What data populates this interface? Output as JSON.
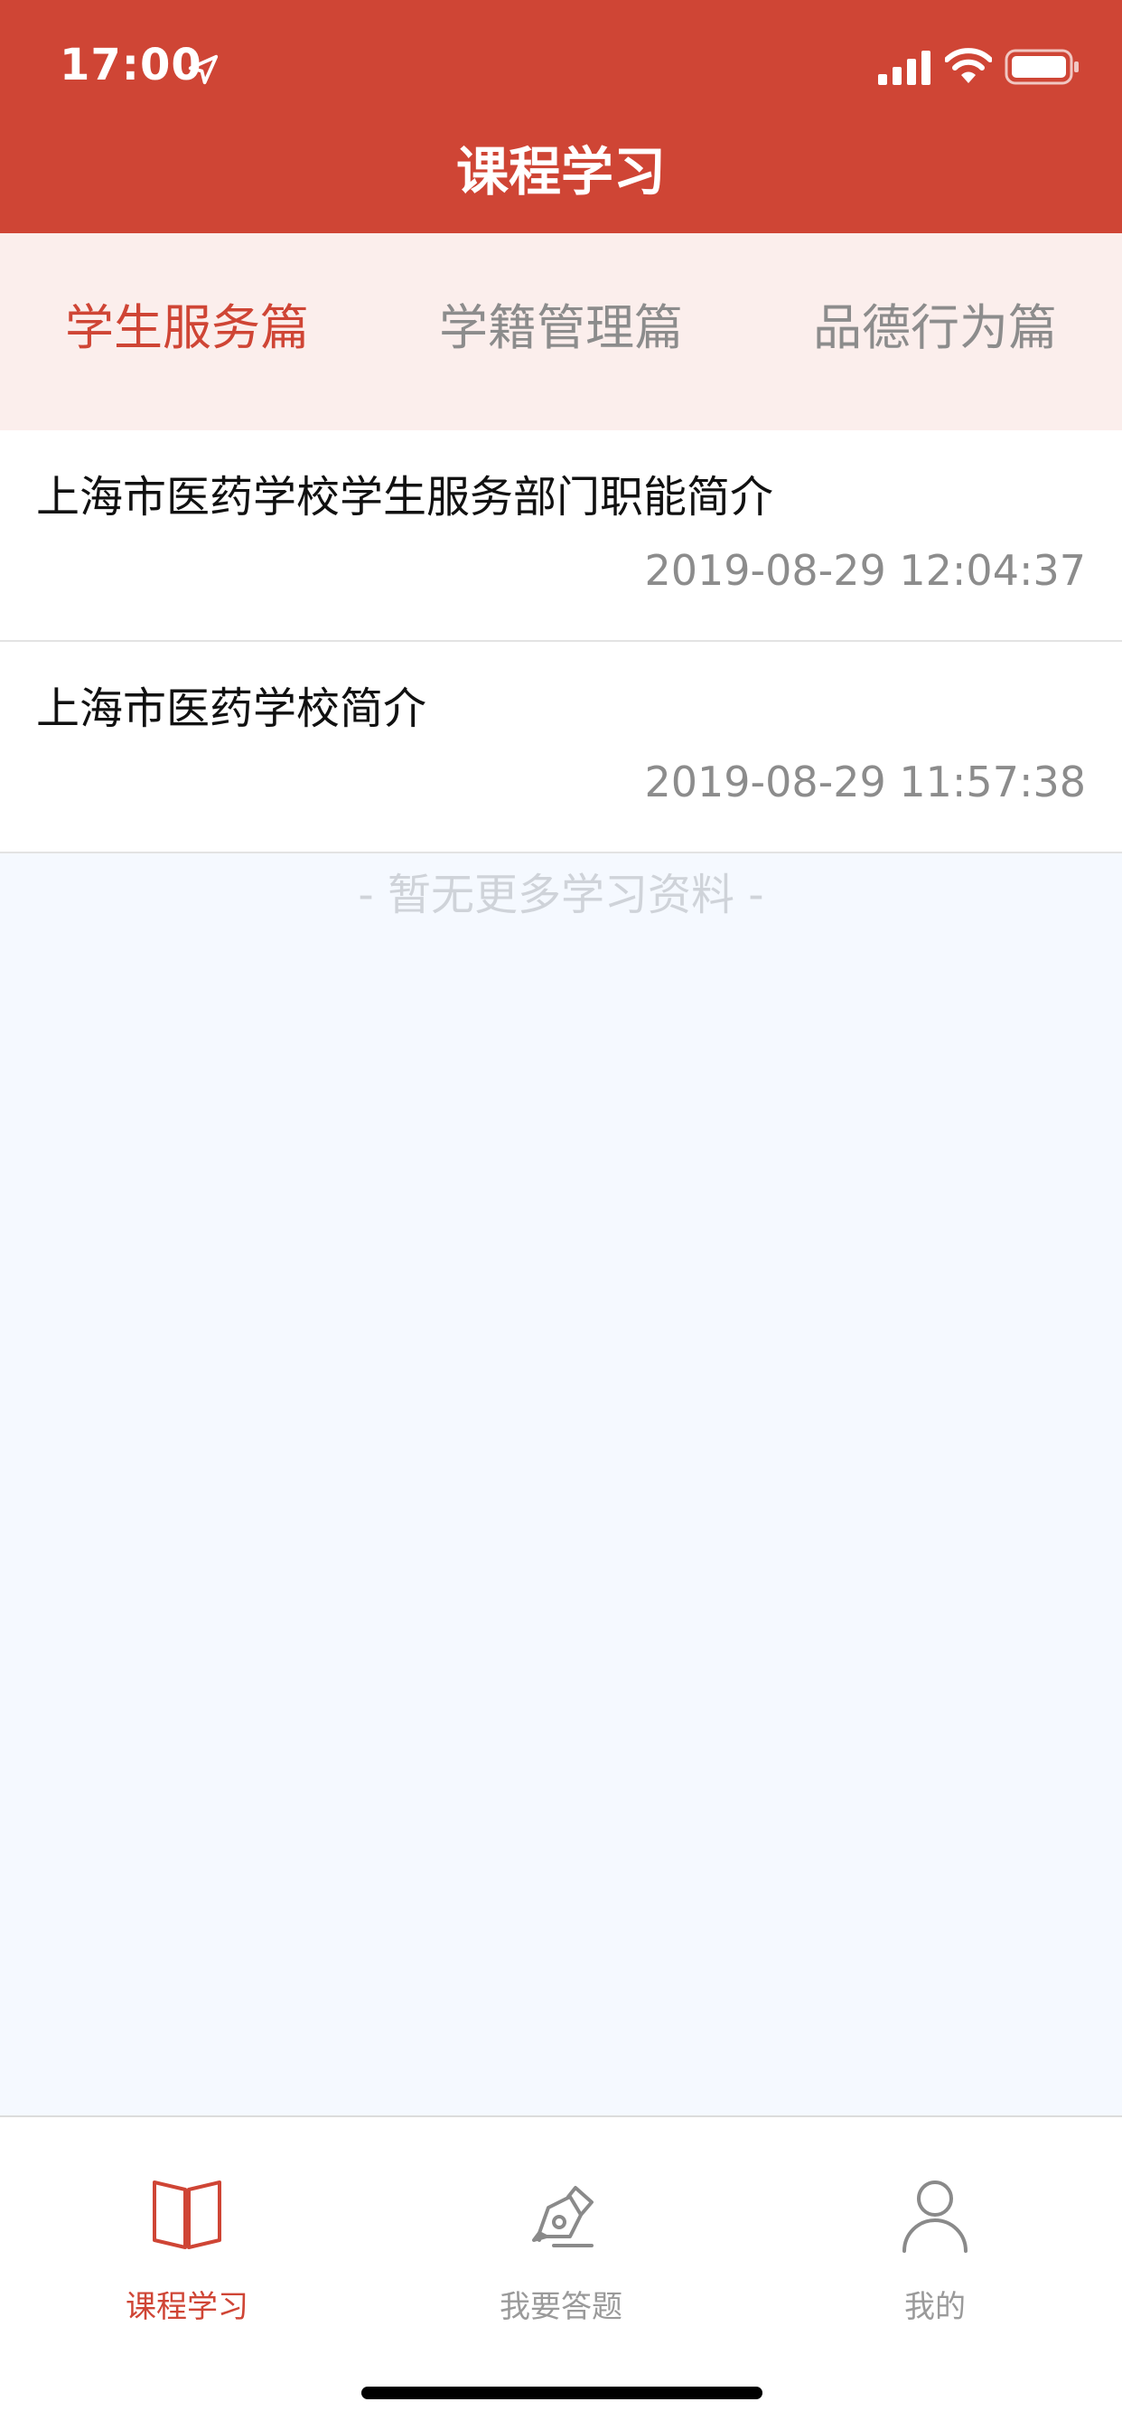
{
  "status_bar": {
    "time": "17:00"
  },
  "header": {
    "title": "课程学习"
  },
  "tabs": [
    {
      "label": "学生服务篇",
      "active": true
    },
    {
      "label": "学籍管理篇",
      "active": false
    },
    {
      "label": "品德行为篇",
      "active": false
    }
  ],
  "list": [
    {
      "title": "上海市医药学校学生服务部门职能简介",
      "time": "2019-08-29 12:04:37"
    },
    {
      "title": "上海市医药学校简介",
      "time": "2019-08-29 11:57:38"
    }
  ],
  "empty_hint": "- 暂无更多学习资料 -",
  "tabbar": [
    {
      "label": "课程学习",
      "icon": "book-icon",
      "active": true
    },
    {
      "label": "我要答题",
      "icon": "pen-icon",
      "active": false
    },
    {
      "label": "我的",
      "icon": "user-icon",
      "active": false
    }
  ],
  "colors": {
    "accent": "#cf4535",
    "tabs_bg": "#fbeeec",
    "page_bg": "#f5f9ff"
  }
}
